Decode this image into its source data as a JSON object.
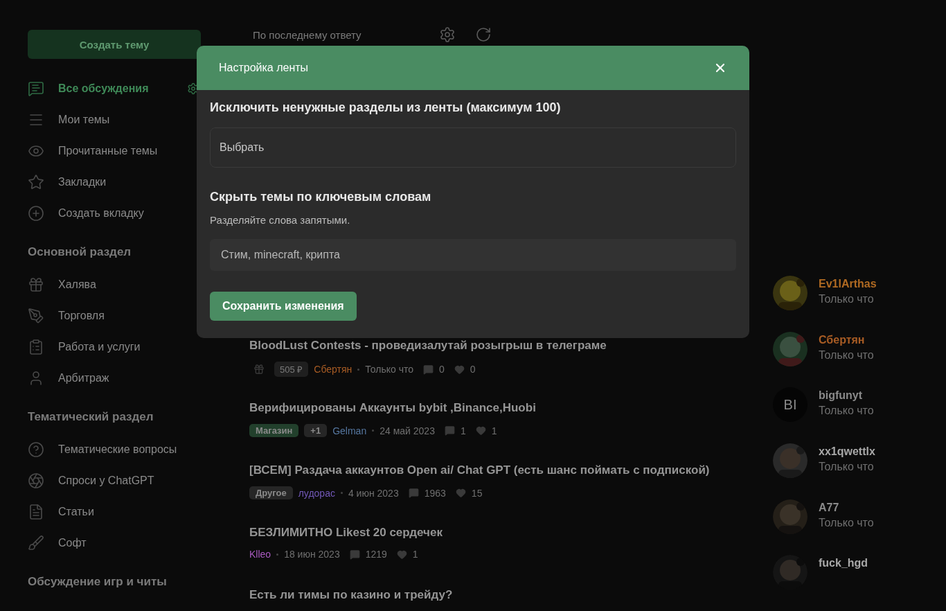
{
  "sidebar": {
    "create_button": "Создать тему",
    "items": [
      {
        "label": "Все обсуждения",
        "selected": true
      },
      {
        "label": "Мои темы",
        "selected": false
      },
      {
        "label": "Прочитанные темы",
        "selected": false
      },
      {
        "label": "Закладки",
        "selected": false
      },
      {
        "label": "Создать вкладку",
        "selected": false
      }
    ],
    "sections": [
      {
        "title": "Основной раздел",
        "items": [
          {
            "label": "Халява"
          },
          {
            "label": "Торговля"
          },
          {
            "label": "Работа и услуги"
          },
          {
            "label": "Арбитраж"
          }
        ]
      },
      {
        "title": "Тематический раздел",
        "items": [
          {
            "label": "Тематические вопросы"
          },
          {
            "label": "Спроси у ChatGPT"
          },
          {
            "label": "Статьи"
          },
          {
            "label": "Софт"
          }
        ]
      },
      {
        "title": "Обсуждение игр и читы"
      }
    ]
  },
  "sort": {
    "label": "По последнему ответу"
  },
  "threads": [
    {
      "title": "BloodLust Contests - проведизалутай розыгрыш в телеграме",
      "prize": "505 ₽",
      "author": {
        "name": "Сбертян",
        "color": "#a85c24"
      },
      "time": "Только что",
      "comments": "0",
      "likes": "0"
    },
    {
      "title": "Верифицированы Аккаунты bybit ,Binance,Huobi",
      "tags": [
        {
          "label": "Магазин",
          "color": "#22402c"
        },
        {
          "label": "+1",
          "color": "#262626"
        }
      ],
      "author": {
        "name": "Gelman",
        "color": "#5677a0"
      },
      "time": "24 май 2023",
      "comments": "1",
      "likes": "1"
    },
    {
      "title": "[ВСЕМ] Раздача аккаунтов Open ai/ Chat GPT (есть шанс поймать с подпиской)",
      "tags": [
        {
          "label": "Другое",
          "color": "#262626"
        }
      ],
      "author": {
        "name": "лудорас",
        "color": "#7258b8"
      },
      "time": "4 июн 2023",
      "comments": "1963",
      "likes": "15"
    },
    {
      "title": "БЕЗЛИМИТНО Likest 20 сердечек",
      "author": {
        "name": "Klleo",
        "color": "#a95ac0"
      },
      "time": "18 июн 2023",
      "comments": "1219",
      "likes": "1"
    },
    {
      "title": "Есть ли тимы по казино и трейду?"
    }
  ],
  "users": [
    {
      "name": "Ev1lArthas",
      "color": "#b06a22",
      "time": "Только что"
    },
    {
      "name": "Сбертян",
      "color": "#a85c24",
      "time": "Только что"
    },
    {
      "name": "bigfunyt",
      "color": "#8a8a8a",
      "time": "Только что",
      "avatar": {
        "kind": "letters",
        "text": "BI"
      }
    },
    {
      "name": "xx1qwettlx",
      "color": "#a8a8a8",
      "time": "Только что"
    },
    {
      "name": "A77",
      "color": "#8a8a8a",
      "time": "Только что"
    },
    {
      "name": "fuck_hgd",
      "color": "#a8a8a8"
    }
  ],
  "modal": {
    "title": "Настройка ленты",
    "exclude": {
      "heading": "Исключить ненужные разделы из ленты (максимум 100)",
      "placeholder": "Выбрать"
    },
    "keywords": {
      "heading": "Скрыть темы по ключевым словам",
      "hint": "Разделяйте слова запятыми.",
      "placeholder": "Стим, minecraft, крипта"
    },
    "save_button": "Сохранить изменения"
  }
}
